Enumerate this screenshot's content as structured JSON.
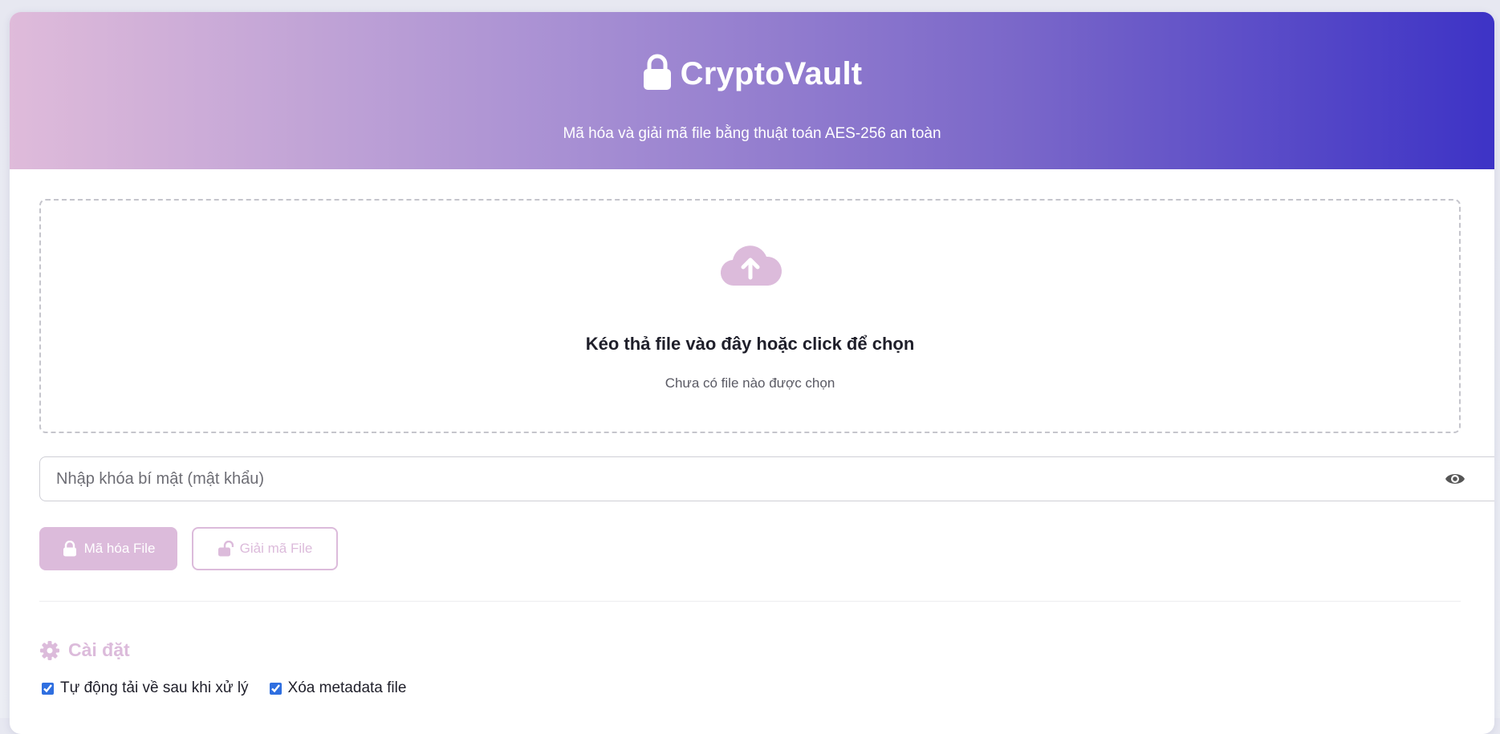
{
  "header": {
    "title": "CryptoVault",
    "subtitle": "Mã hóa và giải mã file bằng thuật toán AES-256 an toàn",
    "icon": "lock-icon"
  },
  "dropzone": {
    "icon": "cloud-upload-icon",
    "title": "Kéo thả file vào đây hoặc click để chọn",
    "status": "Chưa có file nào được chọn"
  },
  "key_input": {
    "placeholder": "Nhập khóa bí mật (mật khẩu)",
    "value": "",
    "toggle_icon": "eye-icon"
  },
  "actions": {
    "encrypt_label": "Mã hóa File",
    "decrypt_label": "Giải mã File"
  },
  "settings": {
    "title": "Cài đặt",
    "options": [
      {
        "label": "Tự động tải về sau khi xử lý",
        "checked": true
      },
      {
        "label": "Xóa metadata file",
        "checked": true
      }
    ]
  },
  "colors": {
    "accent": "#dcbbdb",
    "gradient_start": "#dfbbda",
    "gradient_end": "#3d33c6",
    "checkbox": "#2f6fe0"
  }
}
